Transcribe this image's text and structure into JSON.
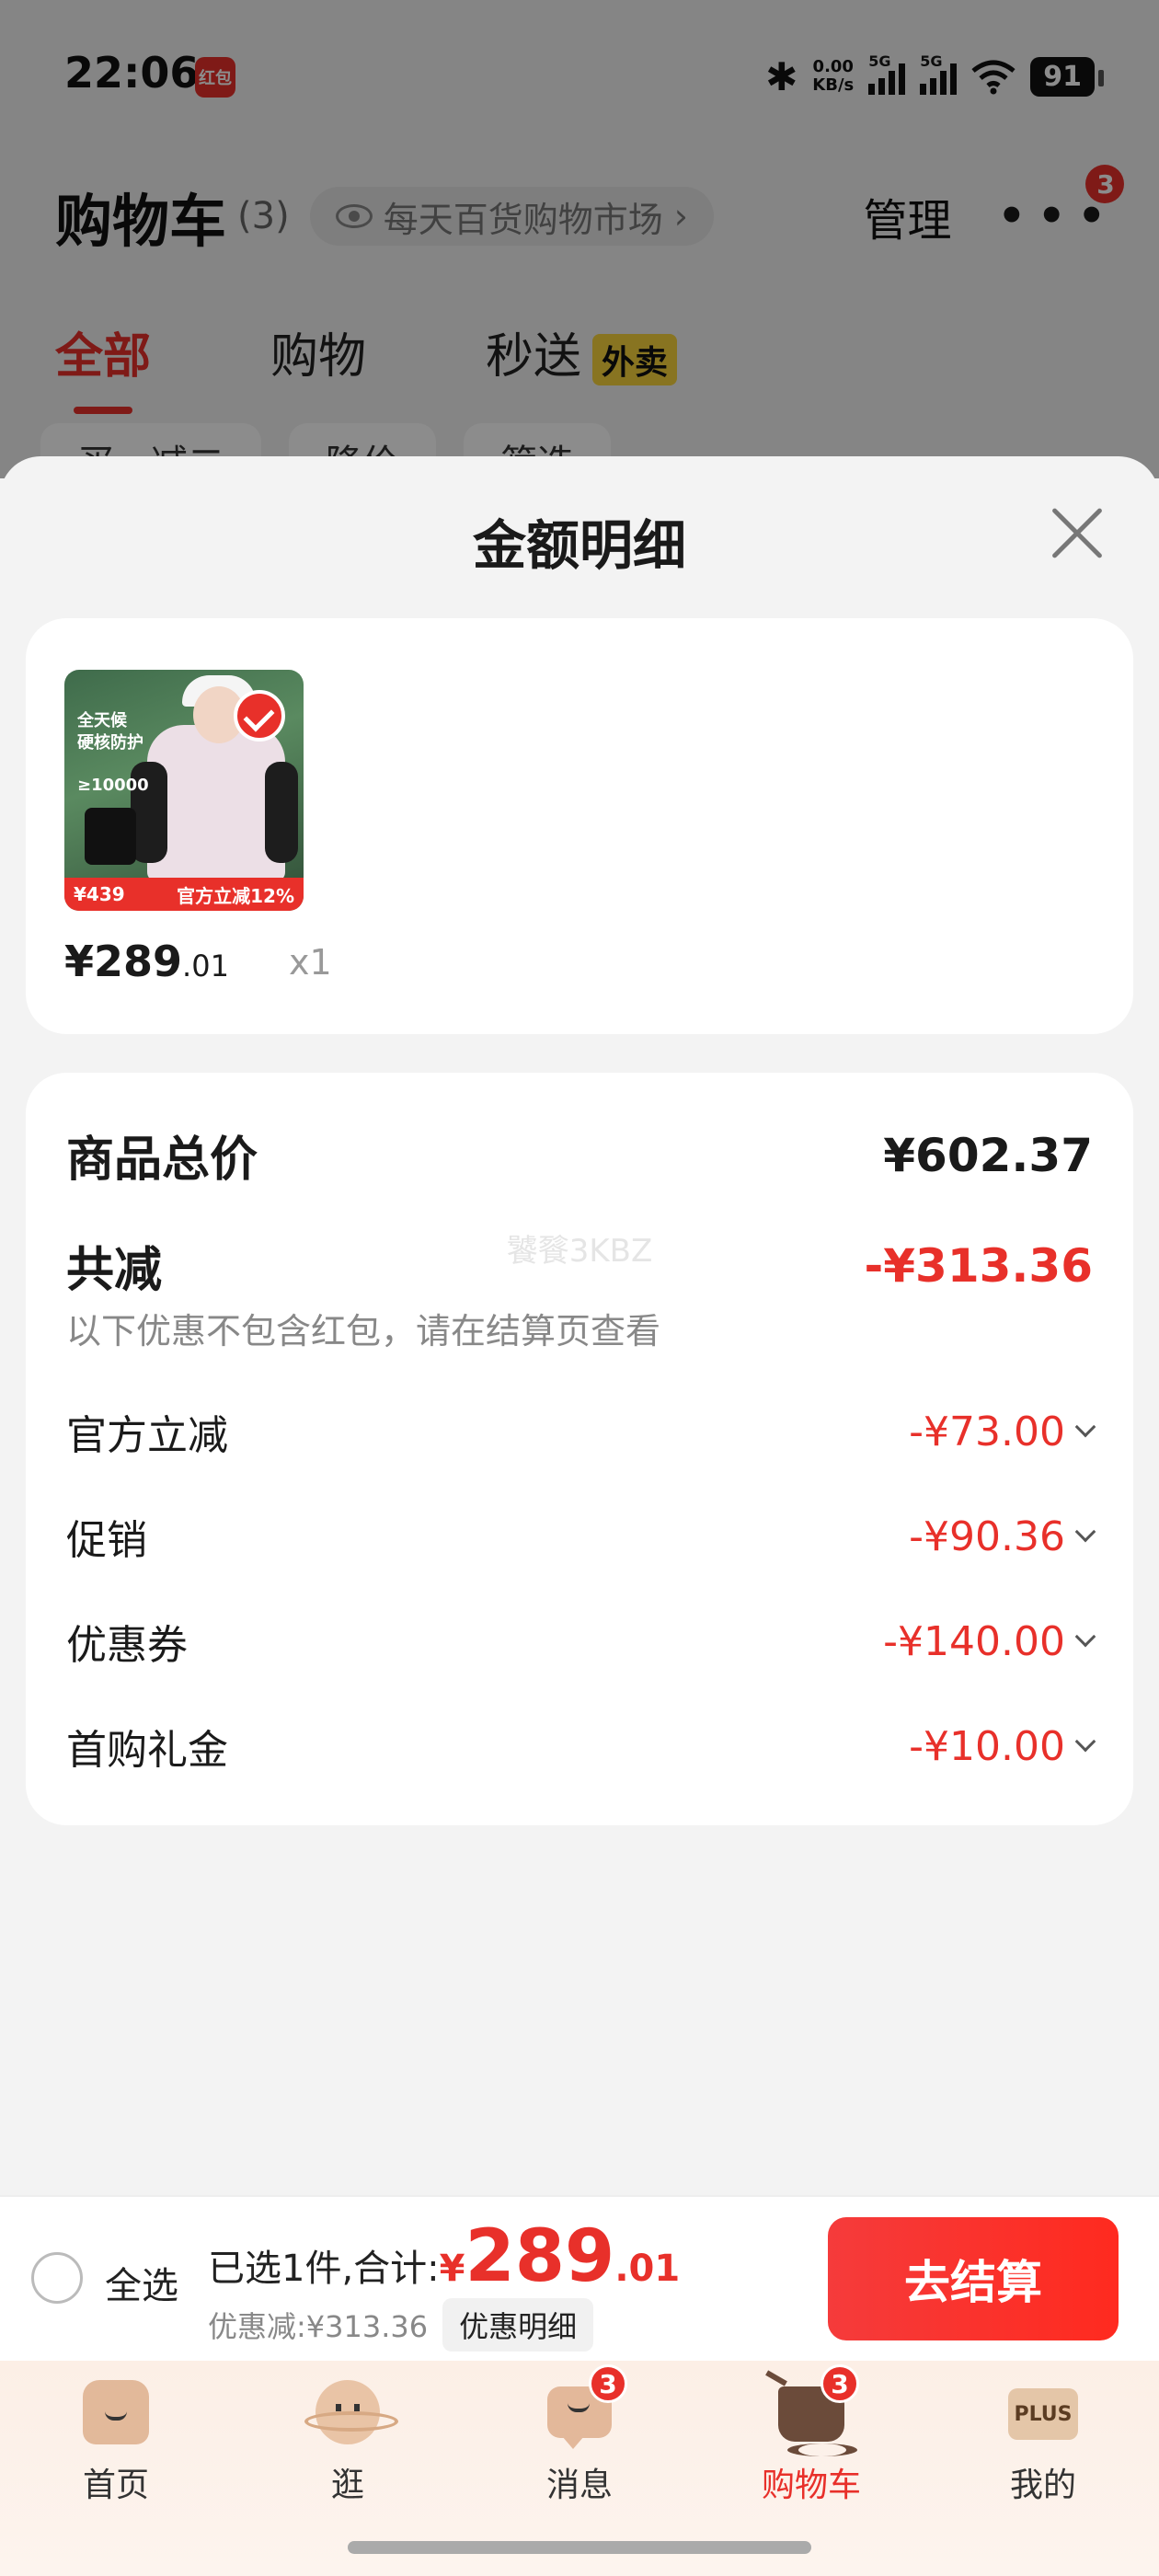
{
  "status_bar": {
    "time": "22:06",
    "app_icon_label": "红包",
    "net_speed_value": "0.00",
    "net_speed_unit": "KB/s",
    "sim1": "5G",
    "sim2": "5G",
    "battery": "91",
    "icons": [
      "bluetooth-icon",
      "signal-icon",
      "wifi-icon",
      "battery-icon"
    ]
  },
  "cart_page": {
    "title": "购物车",
    "count": "(3)",
    "market_label": "每天百货购物市场",
    "market_chevron": "›",
    "manage": "管理",
    "more_badge": "3",
    "tabs": [
      {
        "label": "全部",
        "active": true
      },
      {
        "label": "购物",
        "active": false
      },
      {
        "label": "秒送",
        "active": false,
        "tag": "外卖"
      }
    ],
    "filters": [
      "买一减二",
      "降价",
      "筛选"
    ]
  },
  "sheet": {
    "title": "金额明细",
    "product": {
      "image_text_line1": "全天候",
      "image_text_line2": "硬核防护",
      "image_text_line3": "≥10000",
      "image_price_tag": "¥439",
      "image_promo": "官方立减12%",
      "price_int": "¥289",
      "price_dec": ".01",
      "quantity": "x1",
      "selected": true
    },
    "details": {
      "total_label": "商品总价",
      "total_value": "¥602.37",
      "reduce_label": "共减",
      "reduce_value": "-¥313.36",
      "note": "以下优惠不包含红包，请在结算页查看",
      "watermark": "饕餮3KBZ",
      "items": [
        {
          "label": "官方立减",
          "amount": "-¥73.00"
        },
        {
          "label": "促销",
          "amount": "-¥90.36"
        },
        {
          "label": "优惠券",
          "amount": "-¥140.00"
        },
        {
          "label": "首购礼金",
          "amount": "-¥10.00"
        }
      ]
    }
  },
  "checkout": {
    "select_all": "全选",
    "selected_text": "已选1件,合计:",
    "yen": "¥",
    "total_int": "289",
    "total_dec": ".01",
    "discount_text": "优惠减:¥313.36",
    "detail_button": "优惠明细",
    "checkout_button": "去结算"
  },
  "tab_bar": [
    {
      "label": "首页",
      "icon": "home-icon"
    },
    {
      "label": "逛",
      "icon": "planet-icon"
    },
    {
      "label": "消息",
      "icon": "message-icon",
      "badge": "3"
    },
    {
      "label": "购物车",
      "icon": "cart-icon",
      "badge": "3",
      "active": true
    },
    {
      "label": "我的",
      "icon": "plus-icon",
      "icon_text": "PLUS"
    }
  ],
  "colors": {
    "accent": "#e8302a",
    "waimai_tag": "#f7d33c"
  }
}
